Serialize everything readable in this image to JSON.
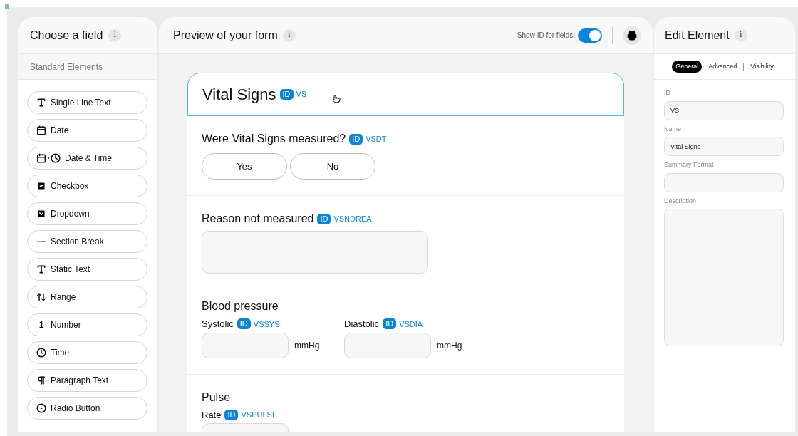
{
  "left_panel": {
    "title": "Choose a field",
    "info": "i",
    "section": "Standard Elements",
    "items": [
      {
        "label": "Single Line Text",
        "kind": "text"
      },
      {
        "label": "Date",
        "kind": "date"
      },
      {
        "label": "Date & Time",
        "kind": "datetime"
      },
      {
        "label": "Checkbox",
        "kind": "checkbox"
      },
      {
        "label": "Dropdown",
        "kind": "dropdown"
      },
      {
        "label": "Section Break",
        "kind": "glyph",
        "glyph": "---"
      },
      {
        "label": "Static Text",
        "kind": "static"
      },
      {
        "label": "Range",
        "kind": "range"
      },
      {
        "label": "Number",
        "kind": "glyph",
        "glyph": "1"
      },
      {
        "label": "Time",
        "kind": "time"
      },
      {
        "label": "Paragraph Text",
        "kind": "paragraph"
      },
      {
        "label": "Radio Button",
        "kind": "radio"
      }
    ]
  },
  "center_panel": {
    "title": "Preview of your form",
    "info": "i",
    "show_id": {
      "label": "Show ID for fields:",
      "on": true
    },
    "form": {
      "title": "Vital Signs",
      "badge": "ID",
      "id": "VS",
      "selected": true,
      "sections": [
        {
          "blocks": [
            {
              "kind": "choice",
              "label": "Were Vital Signs measured?",
              "badge": "ID",
              "id": "VSDT",
              "options": [
                "Yes",
                "No"
              ]
            }
          ]
        },
        {
          "blocks": [
            {
              "kind": "textarea",
              "label": "Reason not measured",
              "badge": "ID",
              "id": "VSNDREA"
            },
            {
              "kind": "group",
              "title": "Blood pressure",
              "fields": [
                {
                  "label": "Systolic",
                  "badge": "ID",
                  "id": "VSSYS",
                  "unit": "mmHg"
                },
                {
                  "label": "Diastolic",
                  "badge": "ID",
                  "id": "VSDIA",
                  "unit": "mmHg"
                }
              ]
            }
          ]
        },
        {
          "blocks": [
            {
              "kind": "group",
              "title": "Pulse",
              "fields": [
                {
                  "label": "Rate",
                  "badge": "ID",
                  "id": "VSPULSE"
                }
              ]
            }
          ]
        }
      ]
    }
  },
  "right_panel": {
    "title": "Edit Element",
    "info": "i",
    "tabs": [
      {
        "label": "General",
        "selected": true
      },
      {
        "label": "Advanced",
        "selected": false
      },
      {
        "label": "Visibility",
        "selected": false
      }
    ],
    "fields": [
      {
        "label": "ID",
        "value": "VS",
        "kind": "input"
      },
      {
        "label": "Name",
        "value": "Vital Signs",
        "kind": "input"
      },
      {
        "label": "Summary Format",
        "kind": "input"
      },
      {
        "label": "Description",
        "kind": "textarea"
      }
    ]
  }
}
